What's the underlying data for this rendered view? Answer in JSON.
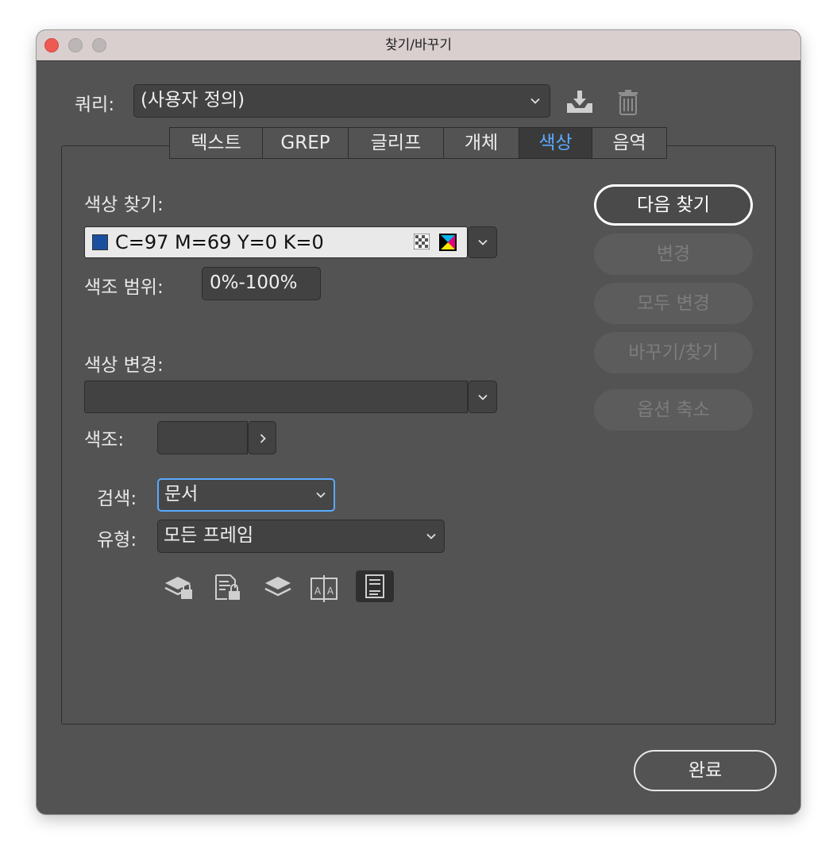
{
  "window": {
    "title": "찾기/바꾸기"
  },
  "query": {
    "label": "쿼리:",
    "value": "(사용자 정의)"
  },
  "tabs": [
    {
      "label": "텍스트"
    },
    {
      "label": "GREP"
    },
    {
      "label": "글리프"
    },
    {
      "label": "개체"
    },
    {
      "label": "색상"
    },
    {
      "label": "음역"
    }
  ],
  "find_color": {
    "label": "색상 찾기:",
    "value": "C=97 M=69 Y=0 K=0",
    "swatch_color": "#1a4fa0"
  },
  "tint_range": {
    "label": "색조 범위:",
    "value": "0%-100%"
  },
  "change_color": {
    "label": "색상 변경:",
    "value": ""
  },
  "tint": {
    "label": "색조:",
    "value": ""
  },
  "search": {
    "label": "검색:",
    "value": "문서"
  },
  "type": {
    "label": "유형:",
    "value": "모든 프레임"
  },
  "buttons": {
    "find_next": "다음 찾기",
    "change": "변경",
    "change_all": "모두 변경",
    "change_find": "바꾸기/찾기",
    "fewer_options": "옵션 축소",
    "done": "완료"
  },
  "colors": {
    "window_bg": "#535353",
    "active_tab": "#5aaaff",
    "focus_ring": "#5aaaff"
  }
}
